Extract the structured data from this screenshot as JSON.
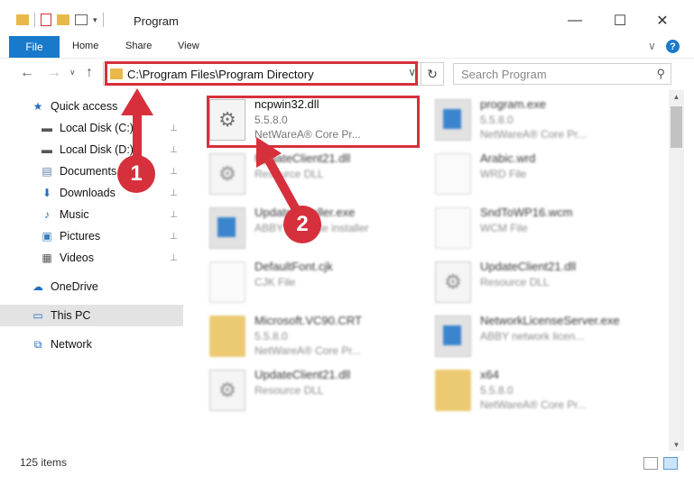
{
  "window": {
    "title": "Program",
    "minimize_glyph": "—",
    "maximize_glyph": "☐",
    "close_glyph": "✕"
  },
  "ribbon": {
    "tabs": [
      {
        "label": "File"
      },
      {
        "label": "Home"
      },
      {
        "label": "Share"
      },
      {
        "label": "View"
      }
    ],
    "expand_glyph": "∨",
    "help_glyph": "?"
  },
  "nav": {
    "back_glyph": "←",
    "forward_glyph": "→",
    "recent_glyph": "∨",
    "up_glyph": "↑",
    "address": "C:\\Program Files\\Program Directory",
    "address_dropdown_glyph": "∨",
    "refresh_glyph": "↻",
    "search_placeholder": "Search Program",
    "search_glyph": "⚲"
  },
  "sidebar": {
    "items": [
      {
        "label": "Quick access",
        "icon": "star-icon",
        "glyph": "★",
        "color": "#1e6fc4",
        "pinned": false
      },
      {
        "label": "Local Disk (C:)",
        "icon": "drive-icon",
        "glyph": "▬",
        "color": "#555555",
        "pinned": true
      },
      {
        "label": "Local Disk (D:)",
        "icon": "drive-icon",
        "glyph": "▬",
        "color": "#555555",
        "pinned": true
      },
      {
        "label": "Documents",
        "icon": "documents-icon",
        "glyph": "▤",
        "color": "#5a7fa8",
        "pinned": true
      },
      {
        "label": "Downloads",
        "icon": "download-icon",
        "glyph": "⬇",
        "color": "#1e6fc4",
        "pinned": true
      },
      {
        "label": "Music",
        "icon": "music-icon",
        "glyph": "♪",
        "color": "#1e6fc4",
        "pinned": true
      },
      {
        "label": "Pictures",
        "icon": "pictures-icon",
        "glyph": "▣",
        "color": "#3a7fc0",
        "pinned": true
      },
      {
        "label": "Videos",
        "icon": "videos-icon",
        "glyph": "▦",
        "color": "#555555",
        "pinned": true
      },
      {
        "label": "OneDrive",
        "icon": "cloud-icon",
        "glyph": "☁",
        "color": "#1e6fc4",
        "pinned": false
      },
      {
        "label": "This PC",
        "icon": "computer-icon",
        "glyph": "▭",
        "color": "#1e6fc4",
        "pinned": false,
        "selected": true
      },
      {
        "label": "Network",
        "icon": "network-icon",
        "glyph": "⧉",
        "color": "#1e6fc4",
        "pinned": false
      }
    ],
    "pin_glyph": "📌"
  },
  "files": [
    {
      "name": "ncpwin32.dll",
      "line1": "5.5.8.0",
      "line2": "NetWareA® Core Pr...",
      "icon": "dll-gear-icon",
      "highlighted": true
    },
    {
      "name": "program.exe",
      "line1": "5.5.8.0",
      "line2": "NetWareA® Core Pr...",
      "icon": "exe-icon"
    },
    {
      "name": "UpdateClient21.dll",
      "line1": "Resource DLL",
      "line2": "",
      "icon": "dll-gear-icon"
    },
    {
      "name": "Arabic.wrd",
      "line1": "WRD File",
      "line2": "",
      "icon": "document-icon"
    },
    {
      "name": "UpdateInstaller.exe",
      "line1": "ABBYY Update installer",
      "line2": "",
      "icon": "exe-icon"
    },
    {
      "name": "SndToWP16.wcm",
      "line1": "WCM File",
      "line2": "",
      "icon": "document-icon"
    },
    {
      "name": "DefaultFont.cjk",
      "line1": "CJK File",
      "line2": "",
      "icon": "document-icon"
    },
    {
      "name": "UpdateClient21.dll",
      "line1": "Resource DLL",
      "line2": "",
      "icon": "dll-gear-icon"
    },
    {
      "name": "Microsoft.VC90.CRT",
      "line1": "5.5.8.0",
      "line2": "NetWareA® Core Pr...",
      "icon": "folder-icon"
    },
    {
      "name": "NetworkLicenseServer.exe",
      "line1": "ABBY network licen...",
      "line2": "",
      "icon": "exe-icon"
    },
    {
      "name": "UpdateClient21.dll",
      "line1": "Resource DLL",
      "line2": "",
      "icon": "dll-gear-icon"
    },
    {
      "name": "x64",
      "line1": "5.5.8.0",
      "line2": "NetWareA® Core Pr...",
      "icon": "folder-icon"
    }
  ],
  "status": {
    "count": "125 items"
  },
  "annotations": {
    "step1": "1",
    "step2": "2"
  },
  "colors": {
    "accent": "#1979ca",
    "highlight": "#d6303c"
  }
}
